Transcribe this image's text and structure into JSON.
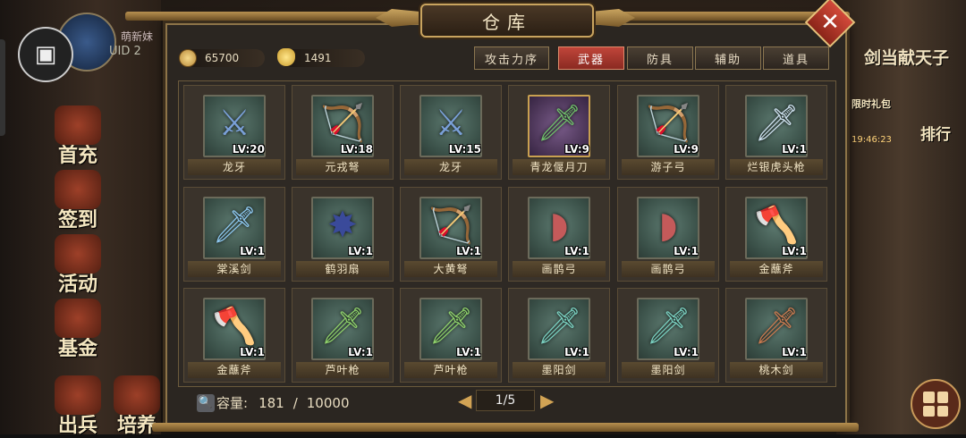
{
  "window": {
    "title": "仓库"
  },
  "player": {
    "name_partial": "萌新妹",
    "uid_label": "UID  2"
  },
  "left_menu": [
    {
      "label": "首充"
    },
    {
      "label": "签到"
    },
    {
      "label": "活动"
    },
    {
      "label": "基金"
    },
    {
      "label": "出兵"
    },
    {
      "label": "培养"
    }
  ],
  "right_side": {
    "banner": "剑当献天子",
    "timer": "19:46:23",
    "rank_label": "排行",
    "gift_label": "限时礼包"
  },
  "currency": {
    "coins": "65700",
    "ingots": "1491"
  },
  "sort_button": "攻击力序",
  "tabs": [
    {
      "label": "武器",
      "active": true
    },
    {
      "label": "防具",
      "active": false
    },
    {
      "label": "辅助",
      "active": false
    },
    {
      "label": "道具",
      "active": false
    }
  ],
  "items": [
    {
      "name": "龙牙",
      "level": "LV:20",
      "icon": "scythe-icon",
      "glyph": "⚔",
      "color": "#7aa0d8"
    },
    {
      "name": "元戎弩",
      "level": "LV:18",
      "icon": "crossbow-icon",
      "glyph": "🏹",
      "color": "#d9c070"
    },
    {
      "name": "龙牙",
      "level": "LV:15",
      "icon": "scythe-icon",
      "glyph": "⚔",
      "color": "#7aa0d8"
    },
    {
      "name": "青龙偃月刀",
      "level": "LV:9",
      "icon": "glaive-icon",
      "glyph": "🗡",
      "color": "#6fbf6a",
      "rare": true
    },
    {
      "name": "游子弓",
      "level": "LV:9",
      "icon": "bow-icon",
      "glyph": "🏹",
      "color": "#c9b070"
    },
    {
      "name": "烂银虎头枪",
      "level": "LV:1",
      "icon": "spear-icon",
      "glyph": "🗡",
      "color": "#cfe2f0"
    },
    {
      "name": "棠溪剑",
      "level": "LV:1",
      "icon": "sword-icon",
      "glyph": "🗡",
      "color": "#8ec8f0"
    },
    {
      "name": "鹤羽扇",
      "level": "LV:1",
      "icon": "fan-icon",
      "glyph": "✸",
      "color": "#3a4a9a"
    },
    {
      "name": "大黄弩",
      "level": "LV:1",
      "icon": "crossbow-icon",
      "glyph": "🏹",
      "color": "#d9a040"
    },
    {
      "name": "画鹊弓",
      "level": "LV:1",
      "icon": "bow-icon",
      "glyph": "◗",
      "color": "#c45a5a"
    },
    {
      "name": "画鹊弓",
      "level": "LV:1",
      "icon": "bow-icon",
      "glyph": "◗",
      "color": "#c45a5a"
    },
    {
      "name": "金蘸斧",
      "level": "LV:1",
      "icon": "axe-icon",
      "glyph": "🪓",
      "color": "#d8c088"
    },
    {
      "name": "金蘸斧",
      "level": "LV:1",
      "icon": "axe-icon",
      "glyph": "🪓",
      "color": "#d8c088"
    },
    {
      "name": "芦叶枪",
      "level": "LV:1",
      "icon": "spear-icon",
      "glyph": "🗡",
      "color": "#8ed06a"
    },
    {
      "name": "芦叶枪",
      "level": "LV:1",
      "icon": "spear-icon",
      "glyph": "🗡",
      "color": "#8ed06a"
    },
    {
      "name": "墨阳剑",
      "level": "LV:1",
      "icon": "sword-icon",
      "glyph": "🗡",
      "color": "#7ad0c0"
    },
    {
      "name": "墨阳剑",
      "level": "LV:1",
      "icon": "sword-icon",
      "glyph": "🗡",
      "color": "#7ad0c0"
    },
    {
      "name": "桃木剑",
      "level": "LV:1",
      "icon": "wooden-sword-icon",
      "glyph": "🗡",
      "color": "#c87a50"
    }
  ],
  "capacity": {
    "label": "容量:",
    "current": "181",
    "separator": "/",
    "max": "10000"
  },
  "pager": {
    "text": "1/5"
  }
}
